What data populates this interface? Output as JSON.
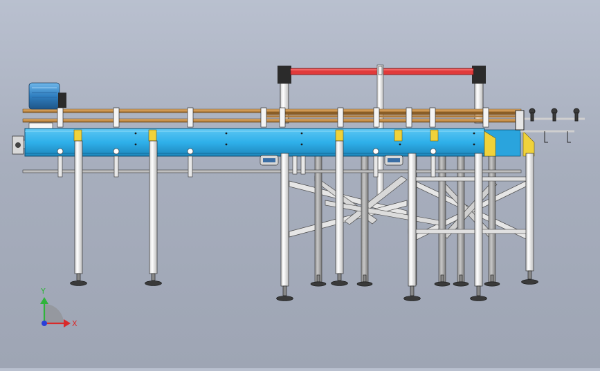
{
  "viewport": {
    "background_top": "#b9c0cf",
    "background_bottom": "#9ea5b4"
  },
  "colors": {
    "frame_blue": "#2fb0ea",
    "frame_blue_dark": "#1d86bb",
    "rail_amber": "#c9924a",
    "gantry_red": "#e03a3a",
    "bracket_yellow": "#f0d23a",
    "leg_white": "#f2f2f2",
    "motor_blue": "#2f7fc0"
  },
  "triad": {
    "y_label": "Y",
    "x_label": "X",
    "y_color": "#2fb43a",
    "x_color": "#d92a2a",
    "origin_color": "#2a3fd9"
  },
  "icons": [
    "drive-motor-icon",
    "gearbox-icon",
    "leveling-foot-icon",
    "axis-triad-icon"
  ]
}
